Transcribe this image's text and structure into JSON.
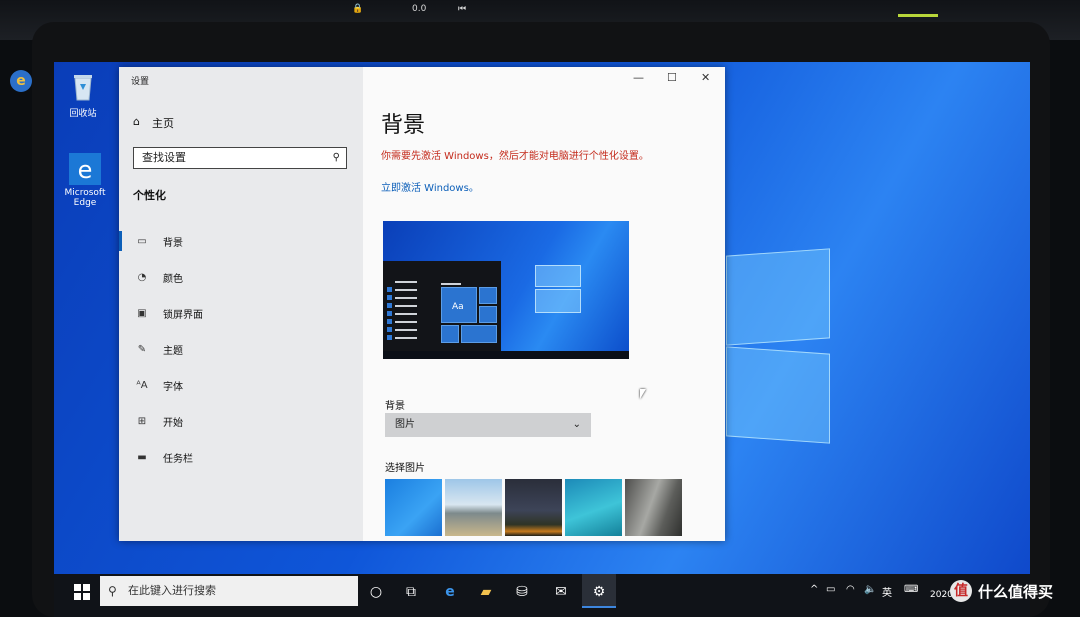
{
  "settings_window": {
    "title": "设置",
    "controls": {
      "minimize": "—",
      "maximize": "☐",
      "close": "✕"
    }
  },
  "sidebar": {
    "home": "主页",
    "search_placeholder": "查找设置",
    "section": "个性化",
    "items": [
      {
        "label": "背景",
        "icon": "image-icon",
        "active": true
      },
      {
        "label": "颜色",
        "icon": "palette-icon",
        "active": false
      },
      {
        "label": "锁屏界面",
        "icon": "lock-screen-icon",
        "active": false
      },
      {
        "label": "主题",
        "icon": "brush-icon",
        "active": false
      },
      {
        "label": "字体",
        "icon": "font-icon",
        "active": false
      },
      {
        "label": "开始",
        "icon": "start-tiles-icon",
        "active": false
      },
      {
        "label": "任务栏",
        "icon": "taskbar-icon",
        "active": false
      }
    ]
  },
  "main": {
    "title": "背景",
    "activation_warning": "你需要先激活 Windows，然后才能对电脑进行个性化设置。",
    "activate_link": "立即激活 Windows。",
    "preview_tile_label": "Aa",
    "background_label": "背景",
    "background_value": "图片",
    "choose_picture_label": "选择图片"
  },
  "desktop": {
    "icons": [
      {
        "label": "回收站",
        "icon": "recycle-bin-icon"
      },
      {
        "label": "Microsoft Edge",
        "icon": "edge-icon"
      }
    ]
  },
  "taskbar": {
    "search_placeholder": "在此键入进行搜索",
    "tray": {
      "ime": "英",
      "date_fragment": "2020"
    }
  },
  "bezel": {
    "top_readout": "0.0"
  },
  "watermark": {
    "badge": "值",
    "text": "什么值得买"
  },
  "colors": {
    "accent": "#0c5fb9",
    "warning": "#c42b1c",
    "sidebar_bg": "#e9eaec",
    "taskbar_bg": "#101318"
  }
}
